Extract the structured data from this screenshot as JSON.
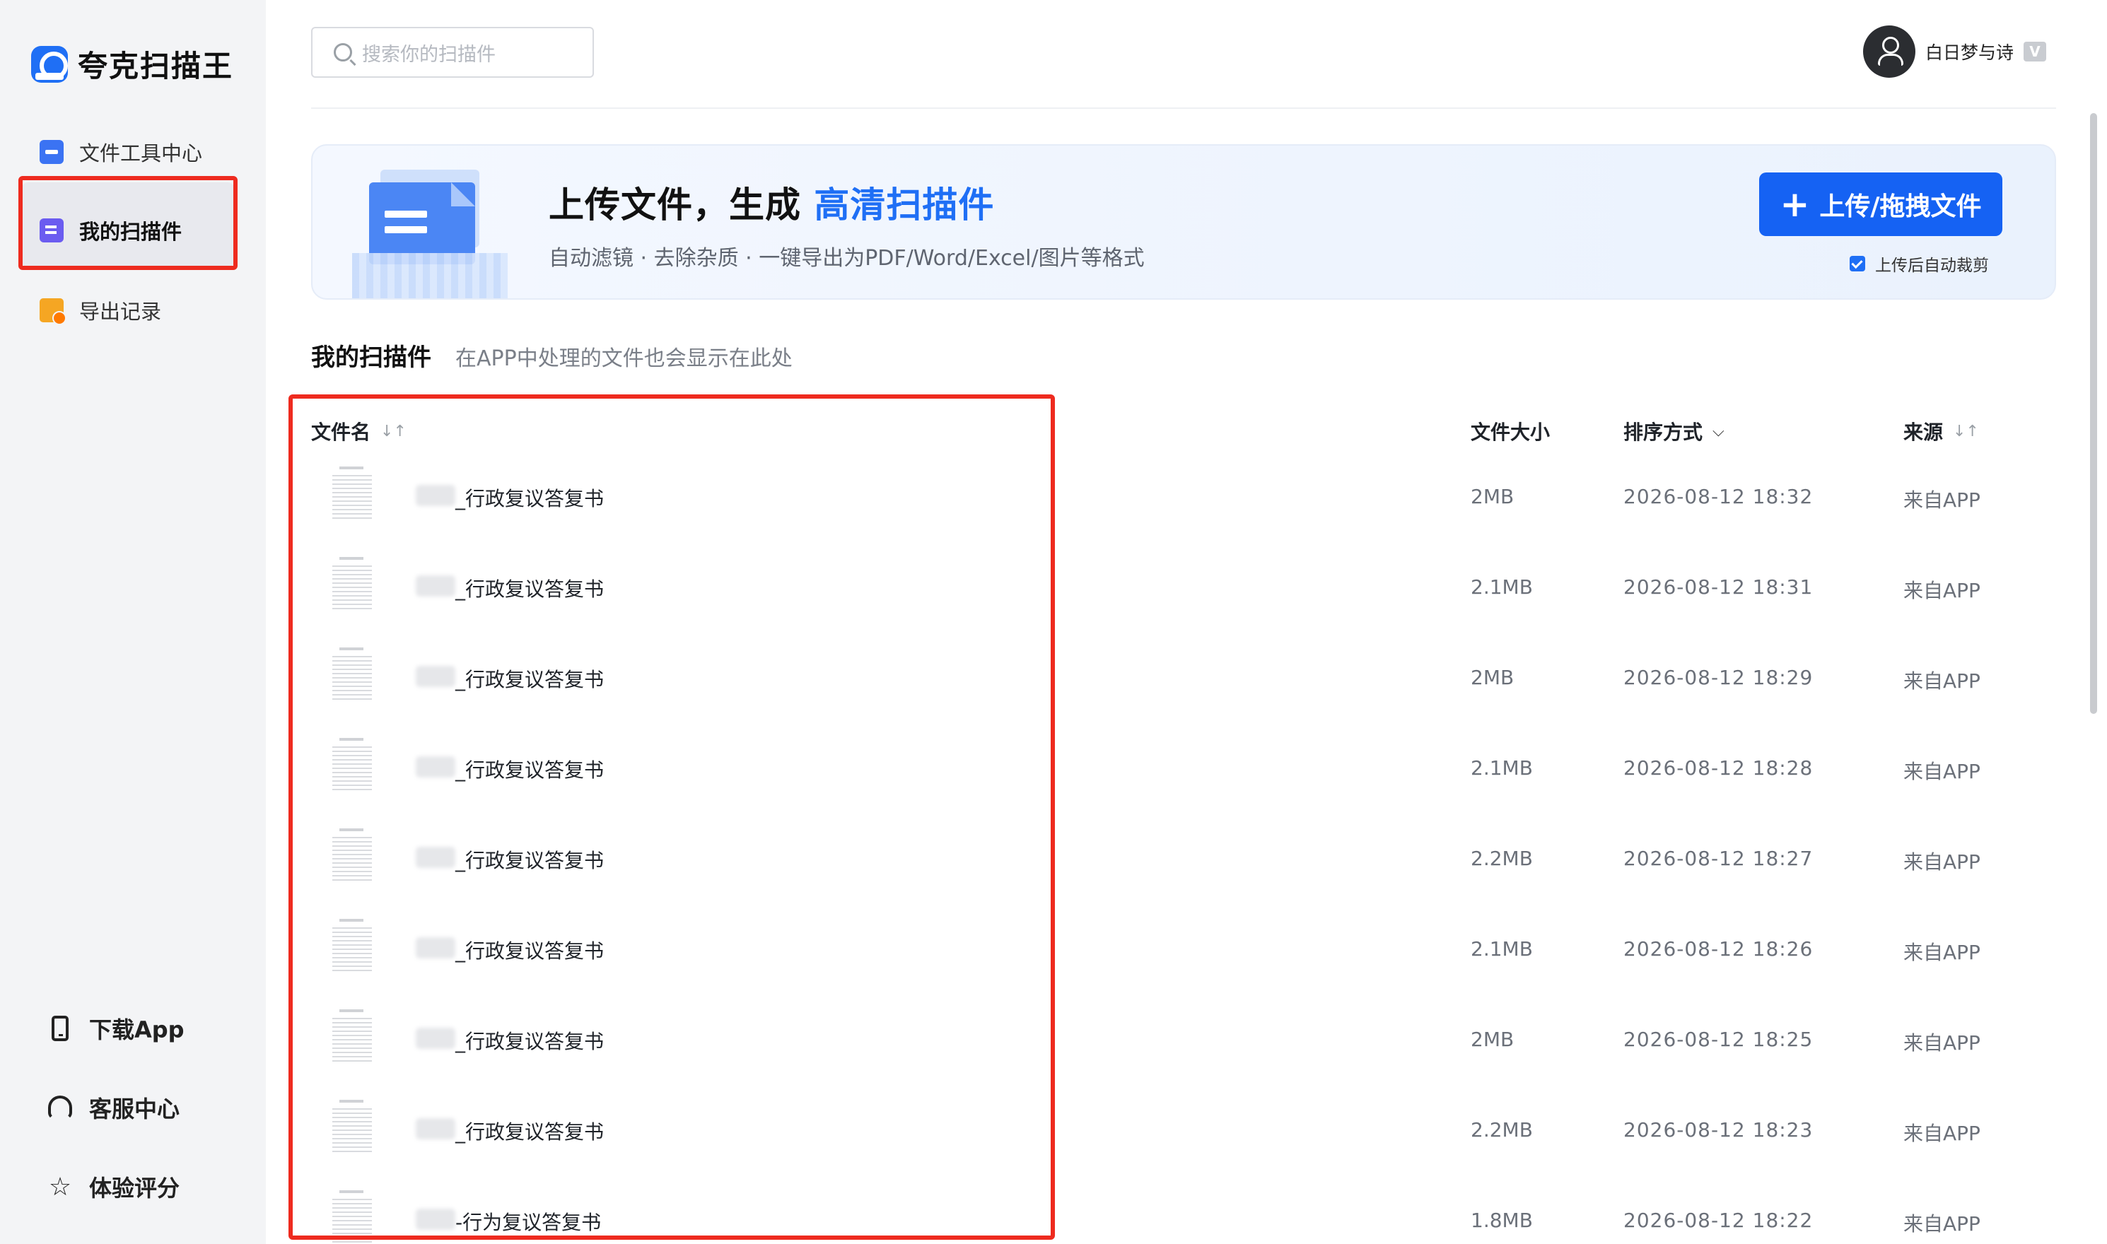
{
  "app": {
    "name": "夸克扫描王"
  },
  "sidebar": {
    "items": [
      {
        "label": "文件工具中心",
        "icon": "briefcase-icon"
      },
      {
        "label": "我的扫描件",
        "icon": "document-icon"
      },
      {
        "label": "导出记录",
        "icon": "folder-clock-icon"
      }
    ],
    "bottom": [
      {
        "label": "下载App",
        "icon": "phone-icon"
      },
      {
        "label": "客服中心",
        "icon": "headset-icon"
      },
      {
        "label": "体验评分",
        "icon": "star-icon"
      }
    ]
  },
  "header": {
    "search_placeholder": "搜索你的扫描件",
    "user_name": "白日梦与诗",
    "vip_badge": "V"
  },
  "banner": {
    "title_prefix": "上传文件，生成",
    "title_highlight": "高清扫描件",
    "subtitle": "自动滤镜 · 去除杂质 · 一键导出为PDF/Word/Excel/图片等格式",
    "upload_button": "上传/拖拽文件",
    "auto_crop_label": "上传后自动裁剪",
    "auto_crop_checked": true
  },
  "section": {
    "title": "我的扫描件",
    "hint": "在APP中处理的文件也会显示在此处"
  },
  "table": {
    "columns": {
      "name": "文件名",
      "size": "文件大小",
      "sort": "排序方式",
      "source": "来源"
    },
    "rows": [
      {
        "name": "_行政复议答复书",
        "size": "2MB",
        "date": "2026-08-12 18:32",
        "source": "来自APP"
      },
      {
        "name": "_行政复议答复书",
        "size": "2.1MB",
        "date": "2026-08-12 18:31",
        "source": "来自APP"
      },
      {
        "name": "_行政复议答复书",
        "size": "2MB",
        "date": "2026-08-12 18:29",
        "source": "来自APP"
      },
      {
        "name": "_行政复议答复书",
        "size": "2.1MB",
        "date": "2026-08-12 18:28",
        "source": "来自APP"
      },
      {
        "name": "_行政复议答复书",
        "size": "2.2MB",
        "date": "2026-08-12 18:27",
        "source": "来自APP"
      },
      {
        "name": "_行政复议答复书",
        "size": "2.1MB",
        "date": "2026-08-12 18:26",
        "source": "来自APP"
      },
      {
        "name": "_行政复议答复书",
        "size": "2MB",
        "date": "2026-08-12 18:25",
        "source": "来自APP"
      },
      {
        "name": "_行政复议答复书",
        "size": "2.2MB",
        "date": "2026-08-12 18:23",
        "source": "来自APP"
      },
      {
        "name": "-行为复议答复书",
        "size": "1.8MB",
        "date": "2026-08-12 18:22",
        "source": "来自APP"
      }
    ]
  },
  "colors": {
    "accent": "#1562f3",
    "highlight_border": "#ee2b1f",
    "sidebar_bg": "#f3f4f6"
  }
}
